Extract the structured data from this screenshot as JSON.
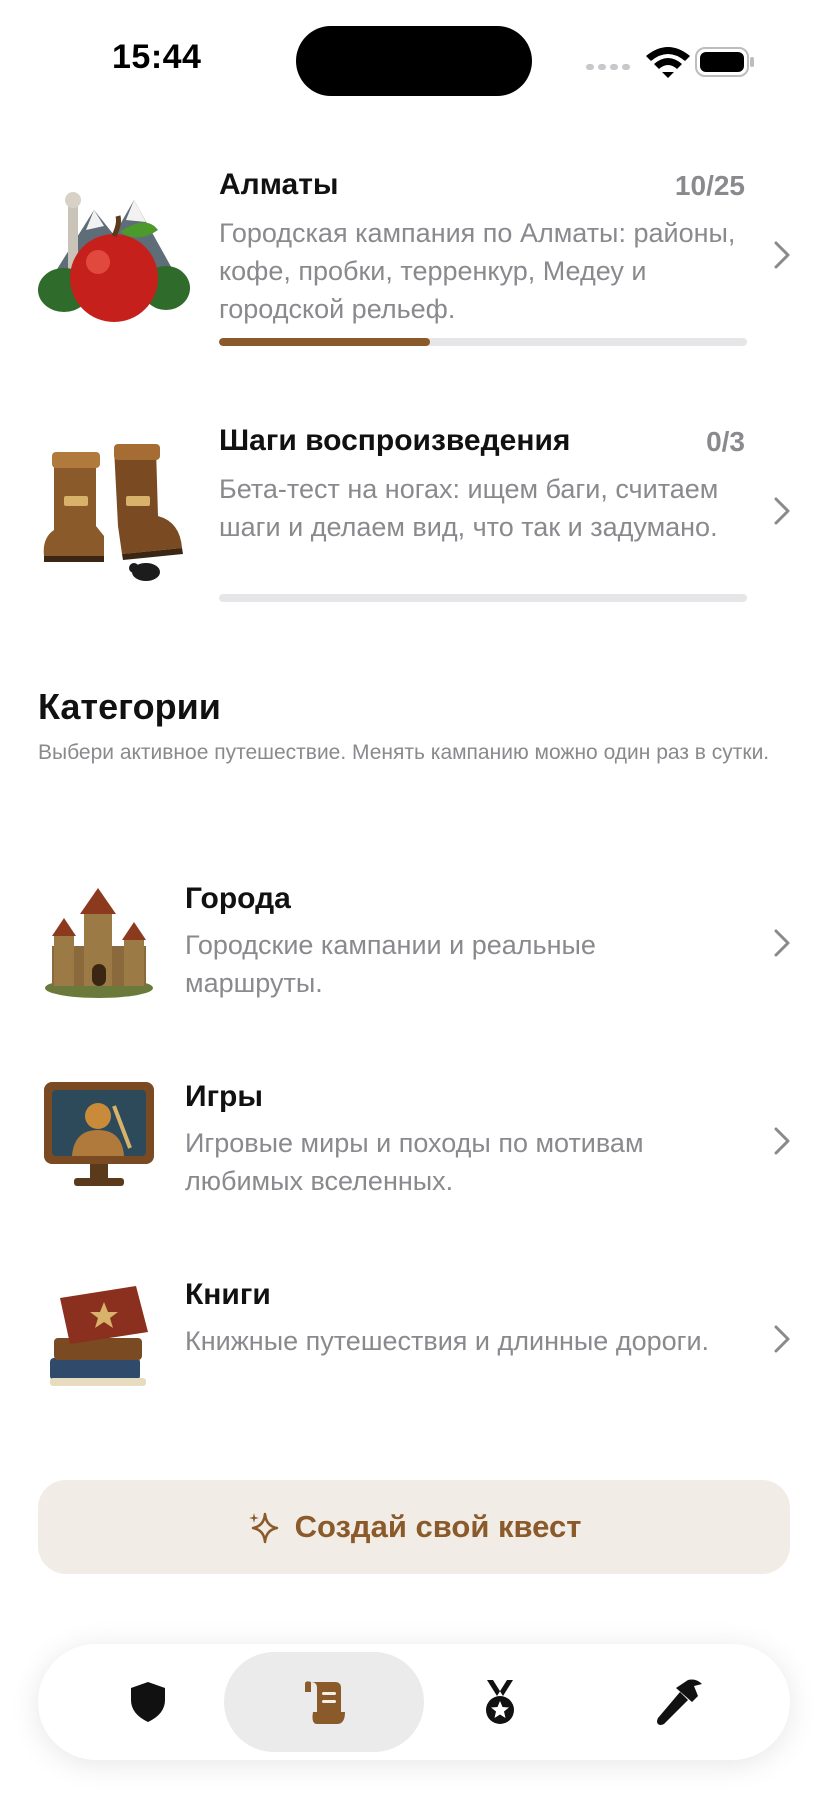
{
  "status_bar": {
    "time": "15:44"
  },
  "campaigns": [
    {
      "title": "Алматы",
      "count": "10/25",
      "progress": 0.4,
      "description": "Городская кампания по Алматы: районы, кофе, пробки, терренкур, Медеу и городской рельеф.",
      "art": "apple-mountain-icon"
    },
    {
      "title": "Шаги воспроизведения",
      "count": "0/3",
      "progress": 0,
      "description": "Бета-тест на ногах: ищем баги, считаем шаги и делаем вид, что так и задумано.",
      "art": "boots-bug-icon"
    }
  ],
  "categories_section": {
    "title": "Категории",
    "subtitle": "Выбери активное путешествие. Менять кампанию можно один раз в сутки.",
    "items": [
      {
        "title": "Города",
        "description": "Городские кампании и реальные маршруты.",
        "art": "castle-icon"
      },
      {
        "title": "Игры",
        "description": "Игровые миры и походы по мотивам любимых вселенных.",
        "art": "monitor-hero-icon"
      },
      {
        "title": "Книги",
        "description": "Книжные путешествия и длинные дороги.",
        "art": "book-stack-icon"
      }
    ]
  },
  "create_button": {
    "label": "Создай свой квест",
    "icon": "sparkle-icon"
  },
  "tab_bar": {
    "tabs": [
      {
        "icon": "shield-icon",
        "active": false
      },
      {
        "icon": "scroll-icon",
        "active": true
      },
      {
        "icon": "medal-icon",
        "active": false
      },
      {
        "icon": "hammer-icon",
        "active": false
      }
    ]
  },
  "colors": {
    "accent": "#8b5a2b",
    "muted_text": "#8a8a8e",
    "button_bg": "#f1ece6",
    "track": "#e6e6e8"
  }
}
